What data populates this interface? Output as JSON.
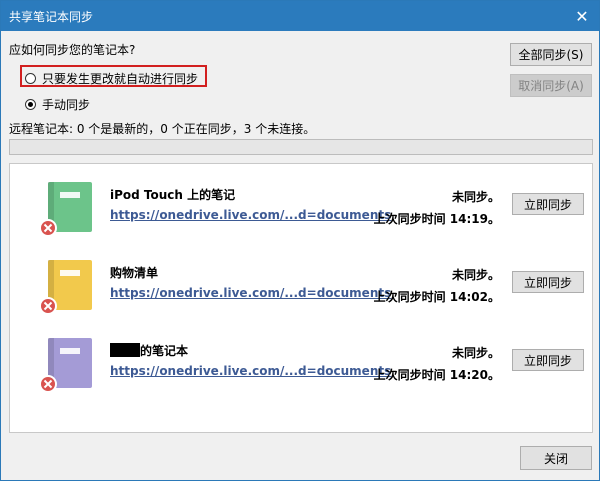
{
  "window": {
    "title": "共享笔记本同步",
    "close_glyph": "✕"
  },
  "sync_prompt": "应如何同步您的笔记本?",
  "options": {
    "auto": "只要发生更改就自动进行同步",
    "manual": "手动同步",
    "selected": "manual"
  },
  "buttons": {
    "sync_all": "全部同步(S)",
    "cancel_sync": "取消同步(A)",
    "close": "关闭"
  },
  "status_text": "远程笔记本: 0 个是最新的，0 个正在同步，3 个未连接。",
  "progress": 0,
  "notebooks": [
    {
      "name": "iPod Touch 上的笔记",
      "name_redacted_prefix": false,
      "link": "https://onedrive.live.com/...d=documents",
      "status": "未同步。",
      "last_sync": "上次同步时间 14:19。",
      "button": "立即同步",
      "color": "#6cc48a",
      "error_icon": "error-x-icon"
    },
    {
      "name": "购物清单",
      "name_redacted_prefix": false,
      "link": "https://onedrive.live.com/...d=documents",
      "status": "未同步。",
      "last_sync": "上次同步时间 14:02。",
      "button": "立即同步",
      "color": "#f2c94c",
      "error_icon": "error-x-icon"
    },
    {
      "name": "的笔记本",
      "name_redacted_prefix": true,
      "link": "https://onedrive.live.com/...d=documents",
      "status": "未同步。",
      "last_sync": "上次同步时间 14:20。",
      "button": "立即同步",
      "color": "#a49bd6",
      "error_icon": "error-x-icon"
    }
  ],
  "colors": {
    "titlebar": "#2b7bbd",
    "highlight": "#d21f1f",
    "link": "#3d5a94",
    "error": "#d9534f"
  }
}
